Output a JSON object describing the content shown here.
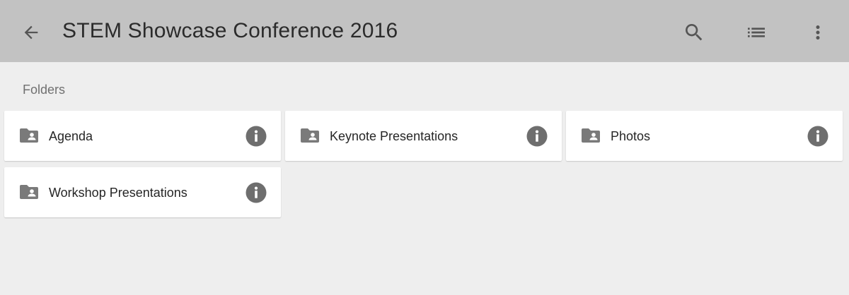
{
  "header": {
    "title": "STEM Showcase Conference 2016",
    "background_color": "#c2c2c2",
    "icons": {
      "back": "arrow-back-icon",
      "search": "search-icon",
      "view": "list-view-icon",
      "menu": "more-vert-icon"
    }
  },
  "main": {
    "section_label": "Folders",
    "background_color": "#eeeeee",
    "folders": [
      {
        "label": "Agenda",
        "icon": "shared-folder-icon",
        "action_icon": "info-icon"
      },
      {
        "label": "Keynote Presentations",
        "icon": "shared-folder-icon",
        "action_icon": "info-icon"
      },
      {
        "label": "Photos",
        "icon": "shared-folder-icon",
        "action_icon": "info-icon"
      },
      {
        "label": "Workshop Presentations",
        "icon": "shared-folder-icon",
        "action_icon": "info-icon"
      }
    ]
  }
}
